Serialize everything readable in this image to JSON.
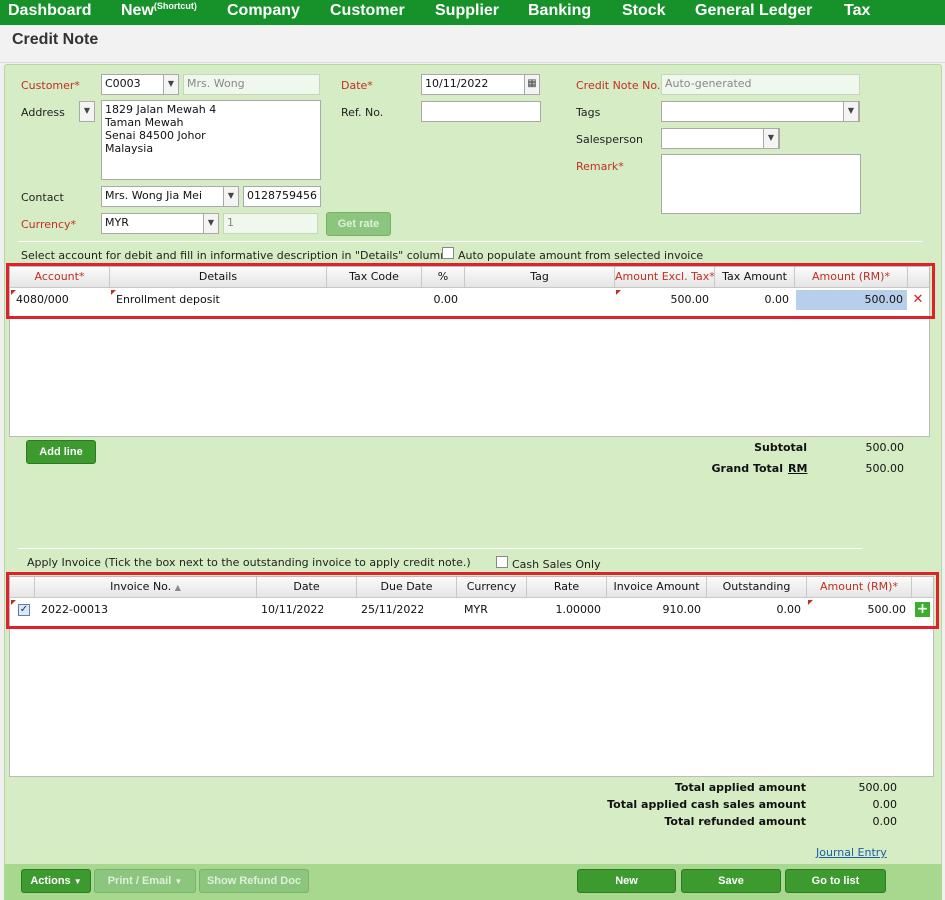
{
  "nav": {
    "items": [
      "Dashboard",
      "New",
      "Company",
      "Customer",
      "Supplier",
      "Banking",
      "Stock",
      "General Ledger",
      "Tax"
    ],
    "new_sup": "(Shortcut)"
  },
  "page": {
    "title": "Credit Note"
  },
  "form": {
    "customer_label": "Customer*",
    "customer_code": "C0003",
    "customer_name": "Mrs. Wong",
    "address_label": "Address",
    "address_lines": [
      "1829 Jalan Mewah 4",
      "Taman Mewah",
      "Senai 84500 Johor",
      "Malaysia"
    ],
    "contact_label": "Contact",
    "contact_name": "Mrs. Wong Jia Mei",
    "contact_phone": "0128759456",
    "currency_label": "Currency*",
    "currency": "MYR",
    "rate": "1",
    "get_rate": "Get rate",
    "date_label": "Date*",
    "date": "10/11/2022",
    "ref_label": "Ref. No.",
    "ref": "",
    "cn_label": "Credit Note No.*",
    "cn_no": "Auto-generated",
    "tags_label": "Tags",
    "sales_label": "Salesperson",
    "remark_label": "Remark*"
  },
  "accounts": {
    "instruction": "Select account for debit and fill in informative description in \"Details\" column.",
    "auto_label": "Auto populate amount from selected invoice",
    "headers": [
      "Account*",
      "Details",
      "Tax Code",
      "%",
      "Tag",
      "Amount Excl. Tax*",
      "Tax Amount",
      "Amount (RM)*"
    ],
    "rows": [
      {
        "account": "4080/000",
        "details": "Enrollment deposit",
        "tax_code": "",
        "pct": "0.00",
        "tag": "",
        "excl": "500.00",
        "tax": "0.00",
        "amount": "500.00"
      }
    ],
    "add_line": "Add line",
    "subtotal_label": "Subtotal",
    "subtotal": "500.00",
    "grand_label": "Grand Total",
    "grand_cur": "RM",
    "grand": "500.00"
  },
  "invoices": {
    "instruction": "Apply Invoice (Tick the box next to the outstanding invoice to apply credit note.)",
    "cash_label": "Cash Sales Only",
    "headers": [
      "Invoice No.",
      "Date",
      "Due Date",
      "Currency",
      "Rate",
      "Invoice Amount",
      "Outstanding",
      "Amount (RM)*"
    ],
    "rows": [
      {
        "inv": "2022-00013",
        "date": "10/11/2022",
        "due": "25/11/2022",
        "cur": "MYR",
        "rate": "1.00000",
        "amount": "910.00",
        "outstanding": "0.00",
        "applied": "500.00"
      }
    ],
    "totals": [
      {
        "label": "Total applied amount",
        "value": "500.00"
      },
      {
        "label": "Total applied cash sales amount",
        "value": "0.00"
      },
      {
        "label": "Total refunded amount",
        "value": "0.00"
      }
    ],
    "journal": "Journal Entry"
  },
  "footer": {
    "actions": "Actions",
    "print": "Print / Email",
    "refund": "Show Refund Doc",
    "new": "New",
    "save": "Save",
    "goto": "Go to list"
  },
  "colors": {
    "nav": "#17922a",
    "panel": "#d6ecc4",
    "button": "#3c9a2e",
    "highlight": "#e0202a"
  }
}
